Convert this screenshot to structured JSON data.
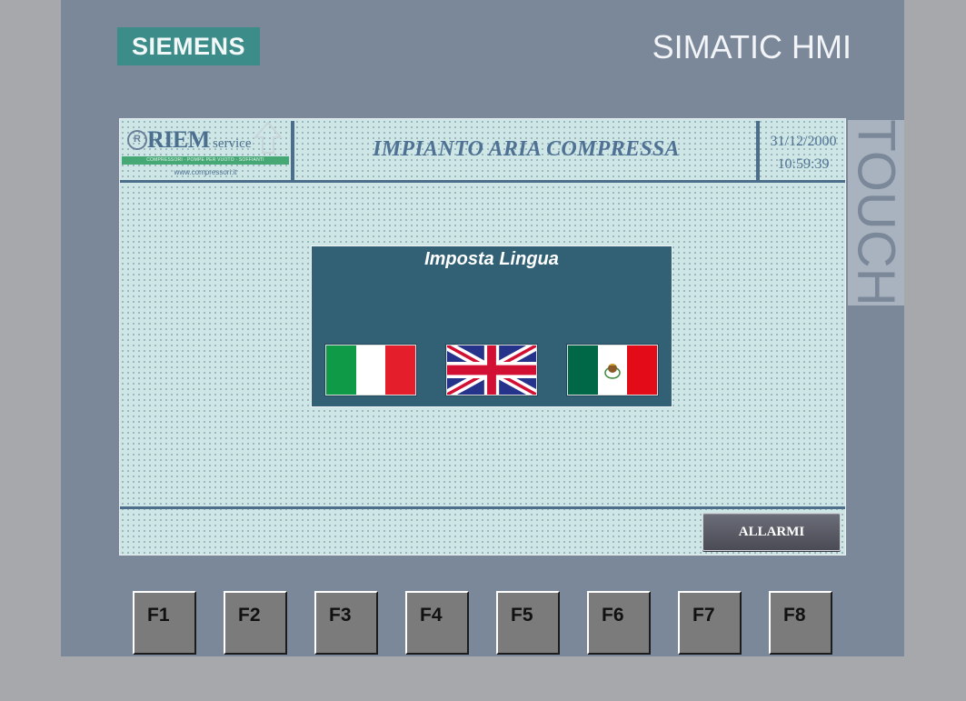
{
  "device": {
    "brand": "SIEMENS",
    "model": "SIMATIC HMI",
    "touch_label": "TOUCH"
  },
  "header": {
    "logo_name": "RIEM",
    "logo_suffix": "service",
    "logo_emblem": "R",
    "logo_tagline": "COMPRESSORI · POMPE PER VUOTO · SOFFIANTI",
    "logo_url": "www.compressori.it",
    "title": "IMPIANTO ARIA COMPRESSA",
    "date": "31/12/2000",
    "time": "10:59:39"
  },
  "language_dialog": {
    "title": "Imposta Lingua",
    "flags": [
      {
        "icon": "italy-flag-icon",
        "colors": [
          "#0f9a48",
          "#ffffff",
          "#e41e2b"
        ]
      },
      {
        "icon": "uk-flag-icon",
        "colors": [
          "#25338a",
          "#ffffff",
          "#d21034"
        ]
      },
      {
        "icon": "mexico-flag-icon",
        "colors": [
          "#006847",
          "#ffffff",
          "#e30b17"
        ]
      }
    ]
  },
  "footer": {
    "alarm_button": "ALLARMI"
  },
  "function_keys": [
    "F1",
    "F2",
    "F3",
    "F4",
    "F5",
    "F6",
    "F7",
    "F8"
  ],
  "colors": {
    "device_bezel": "#7a8899",
    "outer_background": "#a7a8ab",
    "brand_logo": "#3c8c8a",
    "screen_background": "#cfe6e6",
    "dialog_background": "#326074",
    "header_text": "#4f7294"
  }
}
